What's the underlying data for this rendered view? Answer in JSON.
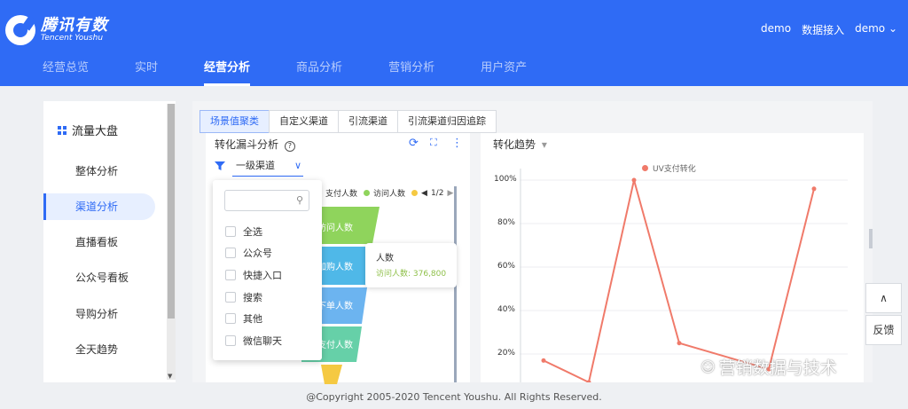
{
  "header": {
    "logo_cn": "腾讯有数",
    "logo_en": "Tencent Youshu",
    "user": "demo",
    "data_access": "数据接入",
    "account": "demo",
    "nav": [
      "经营总览",
      "实时",
      "经营分析",
      "商品分析",
      "营销分析",
      "用户资产"
    ],
    "active_nav": "经营分析"
  },
  "sidebar": {
    "title": "流量大盘",
    "items": [
      "整体分析",
      "渠道分析",
      "直播看板",
      "公众号看板",
      "导购分析",
      "全天趋势"
    ],
    "active": "渠道分析"
  },
  "tabs": [
    "场景值聚类",
    "自定义渠道",
    "引流渠道",
    "引流渠道归因追踪"
  ],
  "active_tab": "场景值聚类",
  "funnel_panel": {
    "title": "转化漏斗分析",
    "help": "?",
    "dropdown": "一级渠道",
    "legend": [
      "支付人数",
      "访问人数"
    ],
    "page": "1/2",
    "bands": [
      "访问人数",
      "加购人数",
      "下单人数",
      "支付人数"
    ],
    "tooltip_title": "人数",
    "tooltip_value": "访问人数: 376,800"
  },
  "filter_popup": {
    "search_placeholder": "",
    "options": [
      "全选",
      "公众号",
      "快捷入口",
      "搜索",
      "其他",
      "微信聊天"
    ]
  },
  "trend_panel": {
    "title": "转化趋势",
    "legend": "UV支付转化"
  },
  "chart_data": {
    "type": "line",
    "series": [
      {
        "name": "UV支付转化",
        "values": [
          17,
          7,
          100,
          25,
          13,
          96
        ]
      }
    ],
    "yticks": [
      "100%",
      "80%",
      "60%",
      "40%",
      "20%"
    ],
    "ylim": [
      0,
      100
    ],
    "color": "#f07a6a"
  },
  "float_buttons": {
    "up": "∧",
    "feedback": "反馈"
  },
  "footer": "@Copyright 2005-2020 Tencent Youshu. All Rights Reserved.",
  "watermark": "营销数据与技术",
  "colors": {
    "brand": "#2f6bf5",
    "active_bg": "#e7efff"
  }
}
